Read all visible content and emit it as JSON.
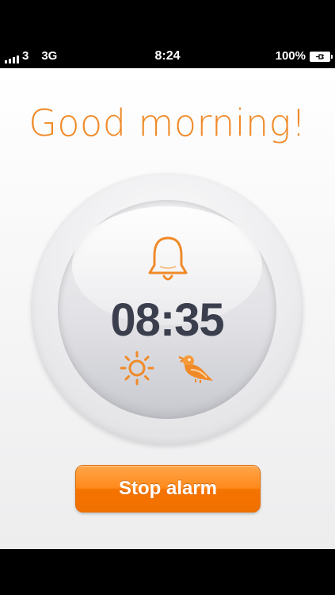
{
  "status_bar": {
    "carrier": "3",
    "network": "3G",
    "time": "8:24",
    "battery_percent": "100%",
    "battery_level": 1.0,
    "signal_bars": 4
  },
  "alarm": {
    "greeting": "Good morning!",
    "time": "08:35",
    "stop_label": "Stop alarm",
    "accent_color": "#f08a28",
    "icons": [
      "bell-icon",
      "sun-icon",
      "bird-icon"
    ]
  }
}
